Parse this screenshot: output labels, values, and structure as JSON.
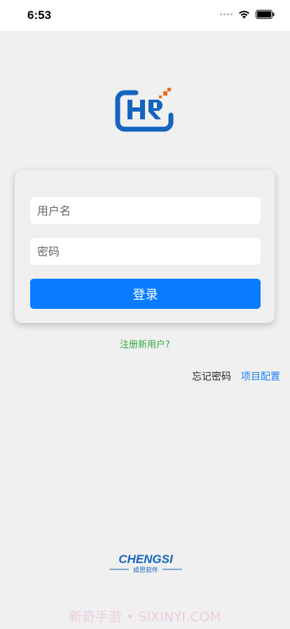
{
  "status_bar": {
    "time": "6:53"
  },
  "logo": {
    "text": "HR",
    "colors": {
      "primary": "#1565c0",
      "accent": "#f26b1d"
    }
  },
  "login_form": {
    "username_placeholder": "用户名",
    "password_placeholder": "密码",
    "login_label": "登录"
  },
  "links": {
    "register": "注册新用户?",
    "forgot_password": "忘记密码",
    "project_config": "项目配置"
  },
  "brand": {
    "name": "CHENGSI",
    "subtitle": "成思软件"
  },
  "watermark": "新奇手游 • SIXINYI.COM",
  "colors": {
    "primary_button": "#0a7cff",
    "register_link": "#2daa3c",
    "config_link": "#1a82ff"
  }
}
